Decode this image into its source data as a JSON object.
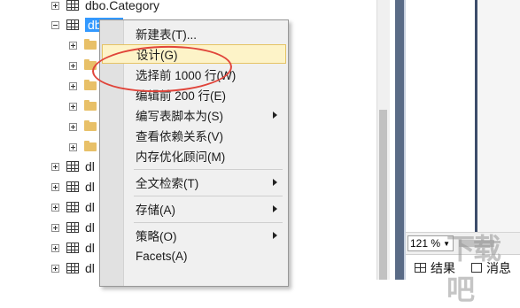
{
  "tree": {
    "items": [
      {
        "type": "table",
        "expander": "plus",
        "label": "dbo.Category"
      },
      {
        "type": "table",
        "expander": "minus",
        "label": "dbo.C"
      },
      {
        "type": "folder",
        "expander": "plus",
        "label": ""
      },
      {
        "type": "folder",
        "expander": "plus",
        "label": ""
      },
      {
        "type": "folder",
        "expander": "plus",
        "label": ""
      },
      {
        "type": "folder",
        "expander": "plus",
        "label": ""
      },
      {
        "type": "folder",
        "expander": "plus",
        "label": ""
      },
      {
        "type": "folder",
        "expander": "plus",
        "label": ""
      },
      {
        "type": "table",
        "expander": "plus",
        "label": "dl"
      },
      {
        "type": "table",
        "expander": "plus",
        "label": "dl"
      },
      {
        "type": "table",
        "expander": "plus",
        "label": "dl"
      },
      {
        "type": "table",
        "expander": "plus",
        "label": "dl"
      },
      {
        "type": "table",
        "expander": "plus",
        "label": "dl"
      },
      {
        "type": "table",
        "expander": "plus",
        "label": "dl"
      }
    ]
  },
  "context_menu": {
    "items": [
      {
        "label": "新建表(T)...",
        "submenu": false
      },
      {
        "label": "设计(G)",
        "submenu": false,
        "highlighted": true
      },
      {
        "label": "选择前 1000 行(W)",
        "submenu": false
      },
      {
        "label": "编辑前 200 行(E)",
        "submenu": false
      },
      {
        "label": "编写表脚本为(S)",
        "submenu": true
      },
      {
        "label": "查看依赖关系(V)",
        "submenu": false
      },
      {
        "label": "内存优化顾问(M)",
        "submenu": false
      },
      {
        "separator": true
      },
      {
        "label": "全文检索(T)",
        "submenu": true
      },
      {
        "separator": true
      },
      {
        "label": "存储(A)",
        "submenu": true
      },
      {
        "separator": true
      },
      {
        "label": "策略(O)",
        "submenu": true
      },
      {
        "label": "Facets(A)",
        "submenu": false
      }
    ]
  },
  "results_panel": {
    "zoom": "121 %",
    "results_tab": "结果",
    "messages_tab": "消息"
  },
  "watermark": "下载吧",
  "colors": {
    "selection": "#3399ff",
    "menu_highlight": "#fdf3c8",
    "annotation_ellipse": "#e0443a",
    "splitter": "#5a6b86"
  }
}
